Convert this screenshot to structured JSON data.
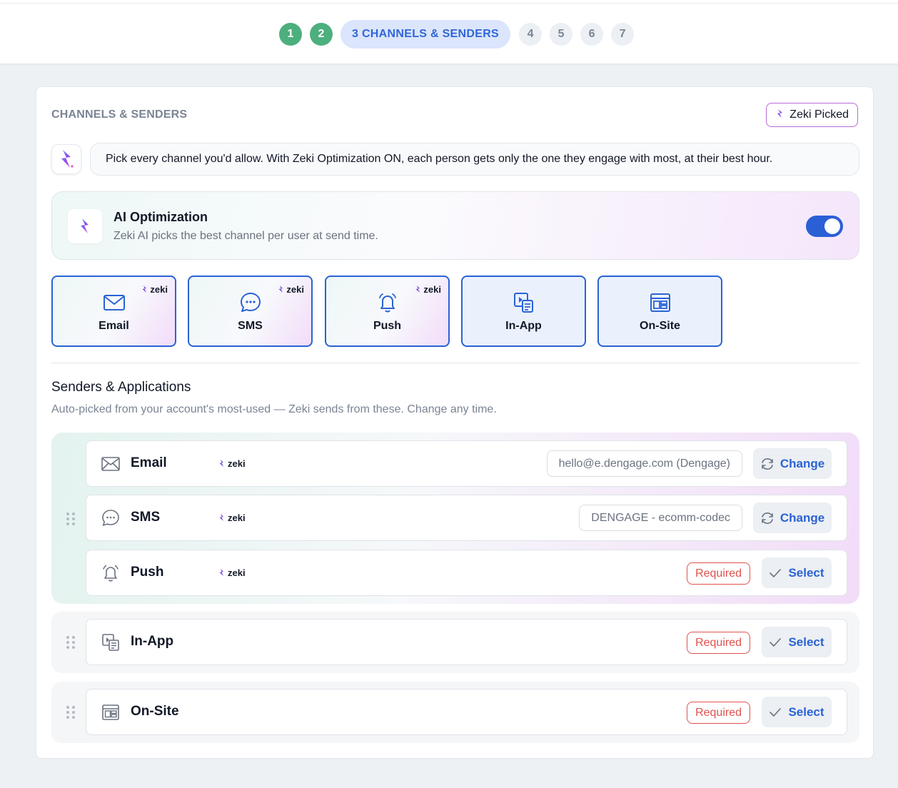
{
  "stepper": {
    "steps": [
      "1",
      "2",
      "3 CHANNELS & SENDERS",
      "4",
      "5",
      "6",
      "7"
    ],
    "current": 3
  },
  "section": {
    "title": "CHANNELS & SENDERS",
    "badge": "Zeki Picked"
  },
  "assistant": {
    "message": "Pick every channel you'd allow. With Zeki Optimization ON, each person gets only the one they engage with most, at their best hour."
  },
  "ai_optimization": {
    "title": "AI Optimization",
    "subtitle": "Zeki AI picks the best channel per user at send time.",
    "enabled": true
  },
  "channels": [
    {
      "label": "Email",
      "icon": "envelope-icon",
      "zeki": "zeki"
    },
    {
      "label": "SMS",
      "icon": "chat-bubble-icon",
      "zeki": "zeki"
    },
    {
      "label": "Push",
      "icon": "bell-icon",
      "zeki": "zeki"
    },
    {
      "label": "In-App",
      "icon": "in-app-message-icon"
    },
    {
      "label": "On-Site",
      "icon": "browser-layout-icon"
    }
  ],
  "senders": {
    "title": "Senders & Applications",
    "subtitle": "Auto-picked from your account's most-used — Zeki sends from these. Change any time.",
    "rows": [
      {
        "name": "Email",
        "zeki": "zeki",
        "value": "hello@e.dengage.com (Dengage)",
        "action": "Change"
      },
      {
        "name": "SMS",
        "zeki": "zeki",
        "value": "DENGAGE - ecomm-codec",
        "action": "Change"
      },
      {
        "name": "Push",
        "zeki": "zeki",
        "status": "Required",
        "action": "Select"
      },
      {
        "name": "In-App",
        "status": "Required",
        "action": "Select"
      },
      {
        "name": "On-Site",
        "status": "Required",
        "action": "Select"
      }
    ]
  },
  "colors": {
    "accent": "#2a63d5",
    "step_done": "#4caf7d",
    "required": "#e0524d",
    "zeki_border": "#b86ad8"
  }
}
